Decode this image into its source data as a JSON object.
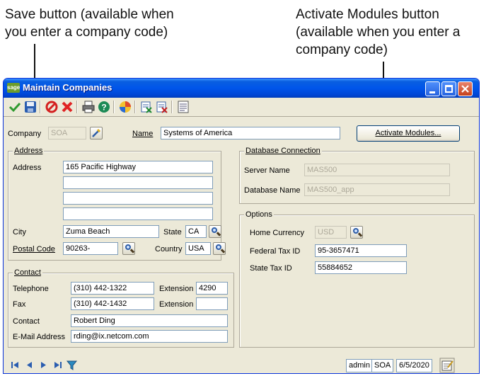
{
  "callouts": {
    "save": "Save button (available when\nyou enter a company code)",
    "activate": "Activate Modules button\n(available when you enter a\ncompany code)"
  },
  "window": {
    "title": "Maintain Companies",
    "logo": "sage",
    "accent": "#0055ea"
  },
  "toolbar": {
    "tools": [
      "accept-icon",
      "save-icon",
      "delete-icon",
      "cancel-icon",
      "print-icon",
      "help-icon",
      "customize-icon",
      "memo-icon",
      "memo-clear-icon",
      "notes-icon"
    ]
  },
  "form": {
    "company_label": "Company",
    "company_value": "SOA",
    "name_label": "Name",
    "name_value": "Systems of America",
    "activate_button": "Activate Modules..."
  },
  "address": {
    "group_title": "Address",
    "address_label": "Address",
    "lines": [
      "165 Pacific Highway",
      "",
      "",
      ""
    ],
    "city_label": "City",
    "city": "Zuma Beach",
    "state_label": "State",
    "state": "CA",
    "postal_label": "Postal Code",
    "postal": "90263-",
    "country_label": "Country",
    "country": "USA"
  },
  "contact": {
    "group_title": "Contact",
    "telephone_label": "Telephone",
    "telephone": "(310) 442-1322",
    "extension_label": "Extension",
    "extension": "4290",
    "fax_label": "Fax",
    "fax": "(310) 442-1432",
    "fax_extension_label": "Extension",
    "fax_extension": "",
    "contact_label": "Contact",
    "contact": "Robert Ding",
    "email_label": "E-Mail Address",
    "email": "rding@ix.netcom.com"
  },
  "database": {
    "group_title": "Database Connection",
    "server_label": "Server Name",
    "server": "MAS500",
    "dbname_label": "Database Name",
    "dbname": "MAS500_app"
  },
  "options": {
    "group_title": "Options",
    "currency_label": "Home Currency",
    "currency": "USD",
    "fedtax_label": "Federal Tax ID",
    "fedtax": "95-3657471",
    "statetax_label": "State Tax ID",
    "statetax": "55884652"
  },
  "status": {
    "user": "admin",
    "company": "SOA",
    "date": "6/5/2020"
  }
}
